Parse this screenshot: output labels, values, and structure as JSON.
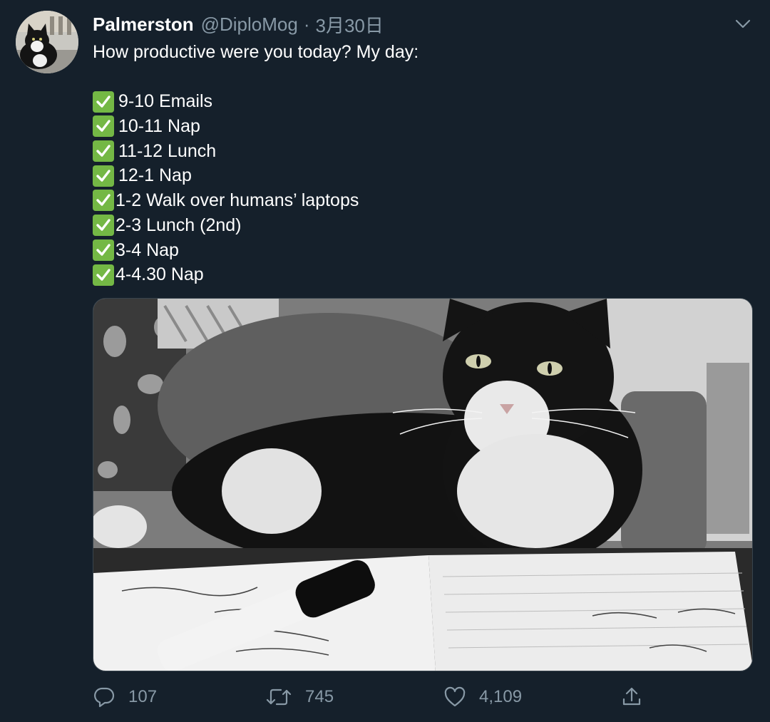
{
  "author": {
    "name": "Palmerston",
    "handle": "@DiploMog",
    "separator": "·",
    "date": "3月30日"
  },
  "tweet": {
    "intro": "How productive were you today? My day:",
    "items": [
      "9-10 Emails",
      "10-11 Nap",
      "11-12 Lunch",
      "12-1 Nap",
      "1-2 Walk over humans’ laptops",
      "2-3 Lunch (2nd)",
      "3-4 Nap",
      "4-4.30 Nap"
    ]
  },
  "actions": {
    "reply_count": "107",
    "retweet_count": "745",
    "like_count": "4,109"
  },
  "icons": {
    "menu": "chevron-down-icon",
    "check": "check-mark-icon",
    "reply": "reply-icon",
    "retweet": "retweet-icon",
    "like": "heart-icon",
    "share": "share-icon"
  },
  "colors": {
    "background": "#15202b",
    "secondary_text": "#8899a6",
    "check_green": "#74b845",
    "border": "#38444d"
  }
}
